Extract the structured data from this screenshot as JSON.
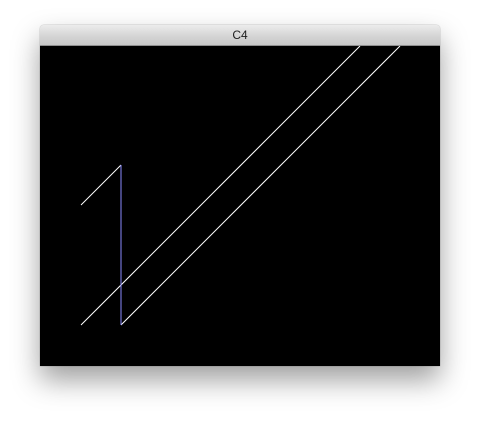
{
  "window": {
    "title": "C4"
  },
  "canvas": {
    "background": "#000000",
    "stroke_colors": {
      "white_line": "#ffffff",
      "blue_line": "#8a8aff"
    }
  }
}
